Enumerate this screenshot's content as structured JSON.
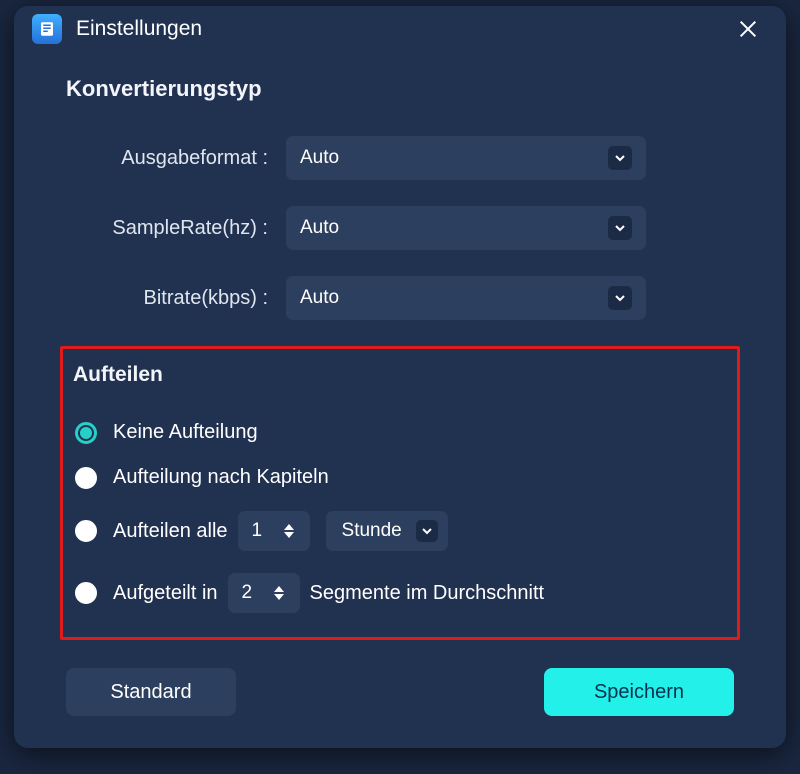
{
  "dialog": {
    "title": "Einstellungen"
  },
  "section1": {
    "title": "Konvertierungstyp",
    "outputFormatLabel": "Ausgabeformat :",
    "outputFormatValue": "Auto",
    "sampleRateLabel": "SampleRate(hz) :",
    "sampleRateValue": "Auto",
    "bitrateLabel": "Bitrate(kbps) :",
    "bitrateValue": "Auto"
  },
  "split": {
    "title": "Aufteilen",
    "opt1": "Keine Aufteilung",
    "opt2": "Aufteilung nach Kapiteln",
    "opt3_prefix": "Aufteilen alle",
    "opt3_value": "1",
    "opt3_unit": "Stunde",
    "opt4_prefix": "Aufgeteilt in",
    "opt4_value": "2",
    "opt4_suffix": "Segmente im Durchschnitt",
    "selectedIndex": 0
  },
  "footer": {
    "default": "Standard",
    "save": "Speichern"
  }
}
